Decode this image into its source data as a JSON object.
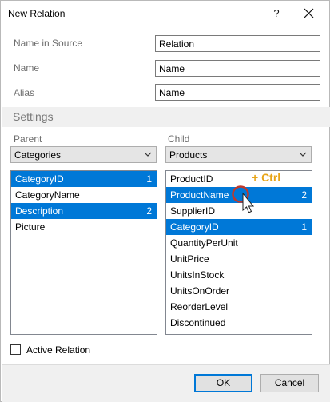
{
  "window": {
    "title": "New Relation"
  },
  "titlebar": {
    "help": "?"
  },
  "form": {
    "name_in_source": {
      "label": "Name in Source",
      "value": "Relation"
    },
    "name": {
      "label": "Name",
      "value": "Name"
    },
    "alias": {
      "label": "Alias",
      "value": "Alias",
      "field_value": "Name"
    }
  },
  "settings": {
    "header": "Settings",
    "parent": {
      "label": "Parent",
      "selected": "Categories",
      "items": [
        {
          "label": "CategoryID",
          "selected": true,
          "order": "1"
        },
        {
          "label": "CategoryName",
          "selected": false,
          "order": ""
        },
        {
          "label": "Description",
          "selected": true,
          "order": "2"
        },
        {
          "label": "Picture",
          "selected": false,
          "order": ""
        }
      ]
    },
    "child": {
      "label": "Child",
      "selected": "Products",
      "items": [
        {
          "label": "ProductID",
          "selected": false,
          "order": ""
        },
        {
          "label": "ProductName",
          "selected": true,
          "order": "2"
        },
        {
          "label": "SupplierID",
          "selected": false,
          "order": ""
        },
        {
          "label": "CategoryID",
          "selected": true,
          "order": "1"
        },
        {
          "label": "QuantityPerUnit",
          "selected": false,
          "order": ""
        },
        {
          "label": "UnitPrice",
          "selected": false,
          "order": ""
        },
        {
          "label": "UnitsInStock",
          "selected": false,
          "order": ""
        },
        {
          "label": "UnitsOnOrder",
          "selected": false,
          "order": ""
        },
        {
          "label": "ReorderLevel",
          "selected": false,
          "order": ""
        },
        {
          "label": "Discontinued",
          "selected": false,
          "order": ""
        }
      ]
    },
    "hint": "+ Ctrl"
  },
  "active_relation": {
    "label": "Active Relation",
    "checked": false
  },
  "buttons": {
    "ok": "OK",
    "cancel": "Cancel"
  },
  "colors": {
    "selection": "#0078d7",
    "hint": "#e8a417",
    "marker": "#c0392b"
  },
  "icons": {
    "close": "close-icon",
    "dropdown": "chevron-down-icon",
    "cursor": "mouse-pointer-icon"
  }
}
